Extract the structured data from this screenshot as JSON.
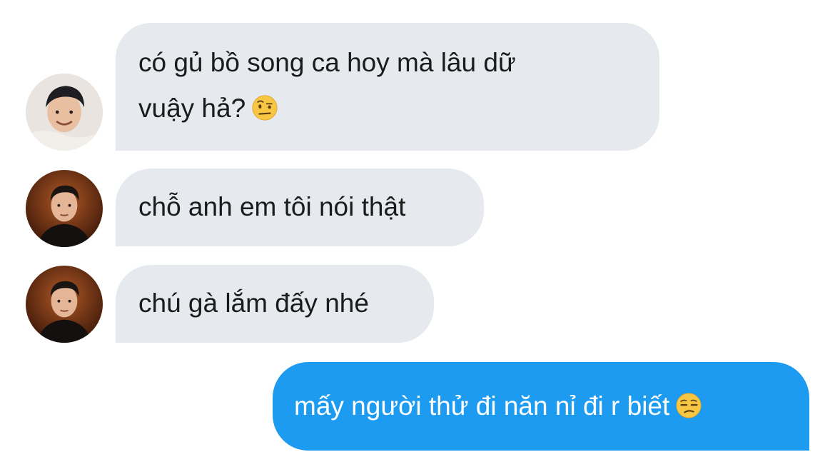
{
  "messages": [
    {
      "direction": "incoming",
      "line1": "có gủ bồ song ca hoy mà lâu dữ",
      "line2": "vuậy hả?",
      "emoji": "raised-eyebrow-emoji",
      "avatar": "avatar-smiling-man"
    },
    {
      "direction": "incoming",
      "text": "chỗ anh em tôi nói thật",
      "avatar": "avatar-man-dark-background"
    },
    {
      "direction": "incoming",
      "text": "chú gà lắm đấy nhé",
      "avatar": "avatar-man-dark-background"
    },
    {
      "direction": "outgoing",
      "text": "mấy người thử đi năn nỉ đi r biết",
      "emoji": "unamused-face-emoji"
    }
  ],
  "colors": {
    "incoming_bubble": "#e6eaef",
    "outgoing_bubble": "#1d9bf0",
    "incoming_text": "#1b1b1b",
    "outgoing_text": "#ffffff"
  }
}
